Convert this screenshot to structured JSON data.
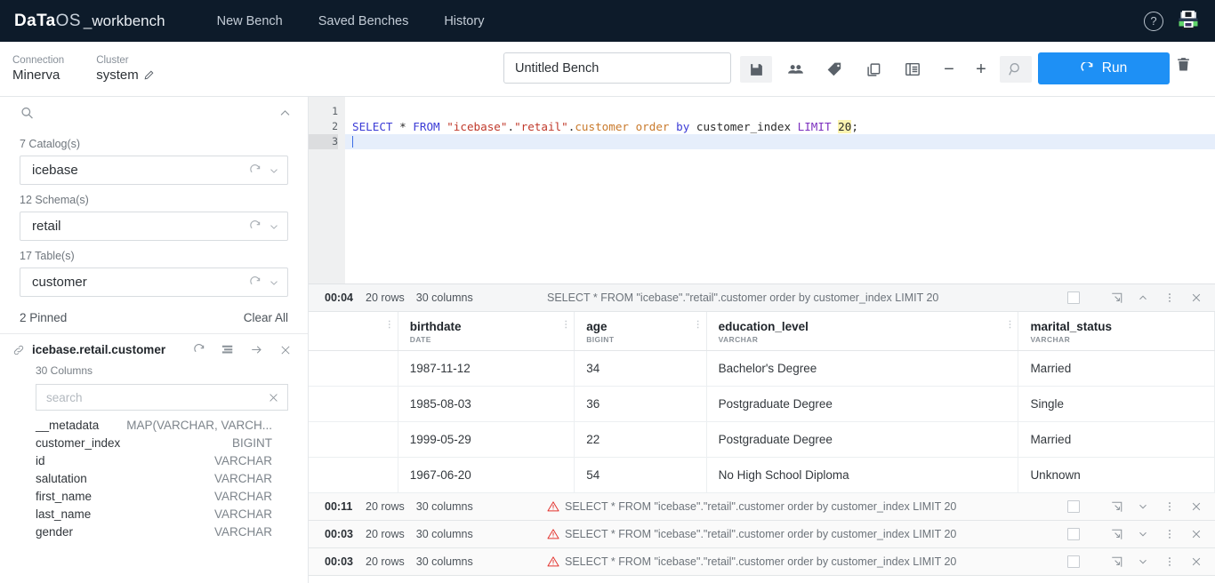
{
  "topnav": {
    "logo_data": "DaTa",
    "logo_os": "OS",
    "logo_workbench": "_workbench",
    "links": [
      {
        "label": "New Bench",
        "name": "nav-new-bench"
      },
      {
        "label": "Saved Benches",
        "name": "nav-saved-benches"
      },
      {
        "label": "History",
        "name": "nav-history"
      }
    ],
    "help_glyph": "?",
    "brand_bg": "#0d1b2a"
  },
  "toolbar": {
    "connection_label": "Connection",
    "connection_value": "Minerva",
    "cluster_label": "Cluster",
    "cluster_value": "system",
    "bench_name": "Untitled Bench",
    "bench_placeholder": "Untitled Bench",
    "icons": [
      {
        "name": "save-icon",
        "title": "Save"
      },
      {
        "name": "share-users-icon",
        "title": "Share"
      },
      {
        "name": "tag-icon",
        "title": "Tag"
      },
      {
        "name": "copy-icon",
        "title": "Copy"
      },
      {
        "name": "format-indent-icon",
        "title": "Format"
      }
    ],
    "zoom_out": "−",
    "zoom_in": "+",
    "find_icon": "search-icon",
    "run_label": "Run",
    "run_color": "#1e90f5",
    "delete_icon": "trash-icon"
  },
  "sidebar": {
    "search_icon": "search-icon",
    "collapse_icon": "chevron-up-icon",
    "selectors": [
      {
        "caption": "7 Catalog(s)",
        "value": "icebase",
        "name": "catalog-select"
      },
      {
        "caption": "12 Schema(s)",
        "value": "retail",
        "name": "schema-select"
      },
      {
        "caption": "17 Table(s)",
        "value": "customer",
        "name": "table-select"
      }
    ],
    "pinned_label": "2 Pinned",
    "clear_all_label": "Clear All",
    "pinned_table": {
      "title": "icebase.retail.customer",
      "columns_label": "30 Columns",
      "search_placeholder": "search",
      "search_value": "",
      "actions": [
        "refresh-icon",
        "table-preview-icon",
        "arrow-right-icon",
        "close-icon"
      ]
    },
    "columns": [
      {
        "name": "__metadata",
        "type": "MAP(VARCHAR, VARCH..."
      },
      {
        "name": "customer_index",
        "type": "BIGINT"
      },
      {
        "name": "id",
        "type": "VARCHAR"
      },
      {
        "name": "salutation",
        "type": "VARCHAR"
      },
      {
        "name": "first_name",
        "type": "VARCHAR"
      },
      {
        "name": "last_name",
        "type": "VARCHAR"
      },
      {
        "name": "gender",
        "type": "VARCHAR"
      }
    ]
  },
  "editor": {
    "line_numbers": [
      "1",
      "2",
      "3"
    ],
    "sql_tokens": [
      {
        "t": "SELECT",
        "c": "kw"
      },
      {
        "t": " ",
        "c": "plain"
      },
      {
        "t": "*",
        "c": "op"
      },
      {
        "t": " ",
        "c": "plain"
      },
      {
        "t": "FROM",
        "c": "kw"
      },
      {
        "t": " ",
        "c": "plain"
      },
      {
        "t": "\"icebase\"",
        "c": "str"
      },
      {
        "t": ".",
        "c": "plain"
      },
      {
        "t": "\"retail\"",
        "c": "str"
      },
      {
        "t": ".",
        "c": "plain"
      },
      {
        "t": "customer",
        "c": "ident"
      },
      {
        "t": " ",
        "c": "plain"
      },
      {
        "t": "order",
        "c": "ident"
      },
      {
        "t": " ",
        "c": "plain"
      },
      {
        "t": "by",
        "c": "kw"
      },
      {
        "t": " ",
        "c": "plain"
      },
      {
        "t": "customer_index",
        "c": "plain"
      },
      {
        "t": " ",
        "c": "plain"
      },
      {
        "t": "LIMIT",
        "c": "kw2"
      },
      {
        "t": " ",
        "c": "plain"
      },
      {
        "t": "20",
        "c": "num"
      },
      {
        "t": ";",
        "c": "plain"
      }
    ],
    "sql_text": "SELECT * FROM \"icebase\".\"retail\".customer order by customer_index LIMIT 20;"
  },
  "results": {
    "active": {
      "time": "00:04",
      "rows": "20 rows",
      "columns": "30 columns",
      "sql": "SELECT * FROM \"icebase\".\"retail\".customer order by customer_index LIMIT 20",
      "has_warning": false,
      "chevron": "^",
      "actions": [
        "expand-icon",
        "collapse-chevron-icon",
        "more-menu-icon",
        "close-icon"
      ]
    },
    "table": {
      "headers": [
        {
          "name": "",
          "type": ""
        },
        {
          "name": "birthdate",
          "type": "DATE"
        },
        {
          "name": "age",
          "type": "BIGINT"
        },
        {
          "name": "education_level",
          "type": "VARCHAR"
        },
        {
          "name": "marital_status",
          "type": "VARCHAR"
        }
      ],
      "rows": [
        [
          "",
          "1987-11-12",
          "34",
          "Bachelor's Degree",
          "Married"
        ],
        [
          "",
          "1985-08-03",
          "36",
          "Postgraduate Degree",
          "Single"
        ],
        [
          "",
          "1999-05-29",
          "22",
          "Postgraduate Degree",
          "Married"
        ],
        [
          "",
          "1967-06-20",
          "54",
          "No High School Diploma",
          "Unknown"
        ]
      ]
    },
    "collapsed": [
      {
        "time": "00:11",
        "rows": "20 rows",
        "columns": "30 columns",
        "sql": "SELECT * FROM \"icebase\".\"retail\".customer order by customer_index LIMIT 20",
        "has_warning": true
      },
      {
        "time": "00:03",
        "rows": "20 rows",
        "columns": "30 columns",
        "sql": "SELECT * FROM \"icebase\".\"retail\".customer order by customer_index LIMIT 20",
        "has_warning": true
      },
      {
        "time": "00:03",
        "rows": "20 rows",
        "columns": "30 columns",
        "sql": "SELECT * FROM \"icebase\".\"retail\".customer order by customer_index LIMIT 20",
        "has_warning": true
      }
    ]
  }
}
